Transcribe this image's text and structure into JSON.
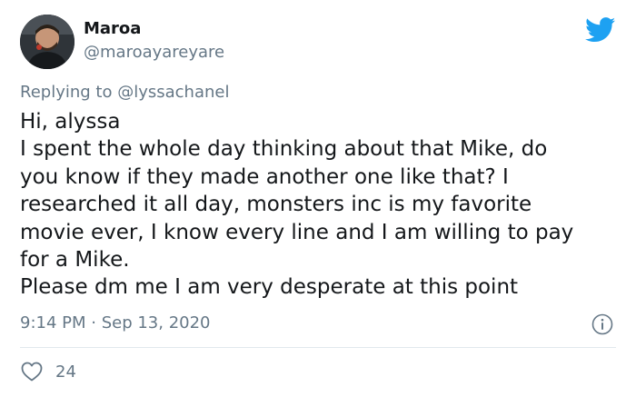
{
  "author": {
    "display_name": "Maroa",
    "handle": "@maroayareyare"
  },
  "reply": {
    "prefix": "Replying to",
    "mention": "@lyssachanel"
  },
  "body_lines": [
    "Hi, alyssa",
    "I spent the whole day thinking about that Mike, do",
    "you know if they made another one like that? I",
    "researched it all day, monsters inc is my favorite",
    "movie ever, I know every line and I am willing to pay",
    "for a Mike.",
    "Please dm me I am very desperate at this point"
  ],
  "timestamp": "9:14 PM · Sep 13, 2020",
  "engagement": {
    "likes": "24"
  },
  "icons": {
    "brand": "twitter-bird-icon",
    "info": "info-icon",
    "like": "heart-icon"
  },
  "colors": {
    "brand": "#1da1f2",
    "text": "#14171a",
    "secondary": "#657786",
    "divider": "#e1e8ed"
  }
}
